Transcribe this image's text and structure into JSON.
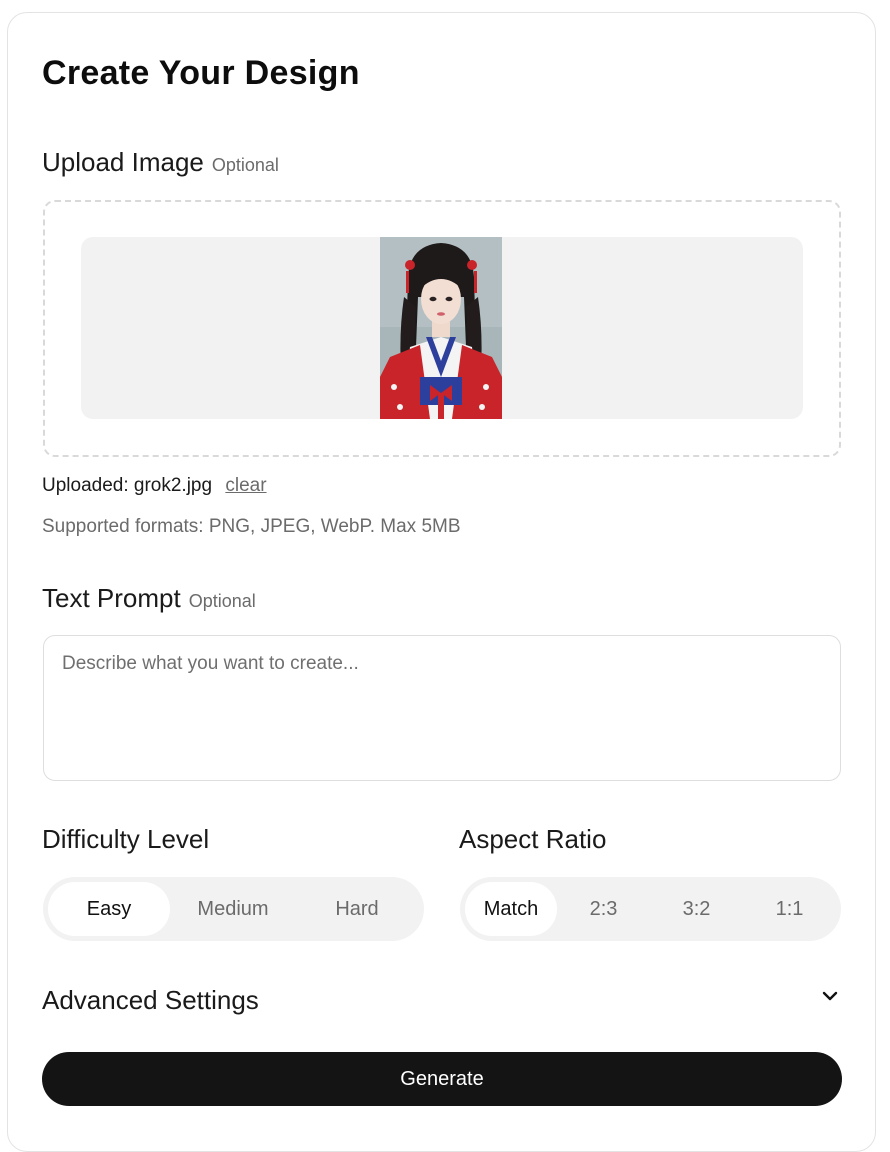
{
  "form": {
    "title": "Create Your Design",
    "upload": {
      "label": "Upload Image",
      "optional": "Optional",
      "uploaded_prefix": "Uploaded:",
      "file_name": "grok2.jpg",
      "clear_label": "clear",
      "formats_note": "Supported formats: PNG, JPEG, WebP. Max 5MB"
    },
    "prompt": {
      "label": "Text Prompt",
      "optional": "Optional",
      "placeholder": "Describe what you want to create...",
      "value": ""
    },
    "difficulty": {
      "label": "Difficulty Level",
      "options": [
        "Easy",
        "Medium",
        "Hard"
      ],
      "selected": "Easy"
    },
    "aspect_ratio": {
      "label": "Aspect Ratio",
      "options": [
        "Match",
        "2:3",
        "3:2",
        "1:1"
      ],
      "selected": "Match"
    },
    "advanced": {
      "label": "Advanced Settings",
      "icon": "chevron-down-icon",
      "expanded": false
    },
    "generate_label": "Generate"
  },
  "colors": {
    "primary_button": "#141414",
    "segment_track": "#f2f2f2",
    "muted_text": "#6b6b6b"
  }
}
